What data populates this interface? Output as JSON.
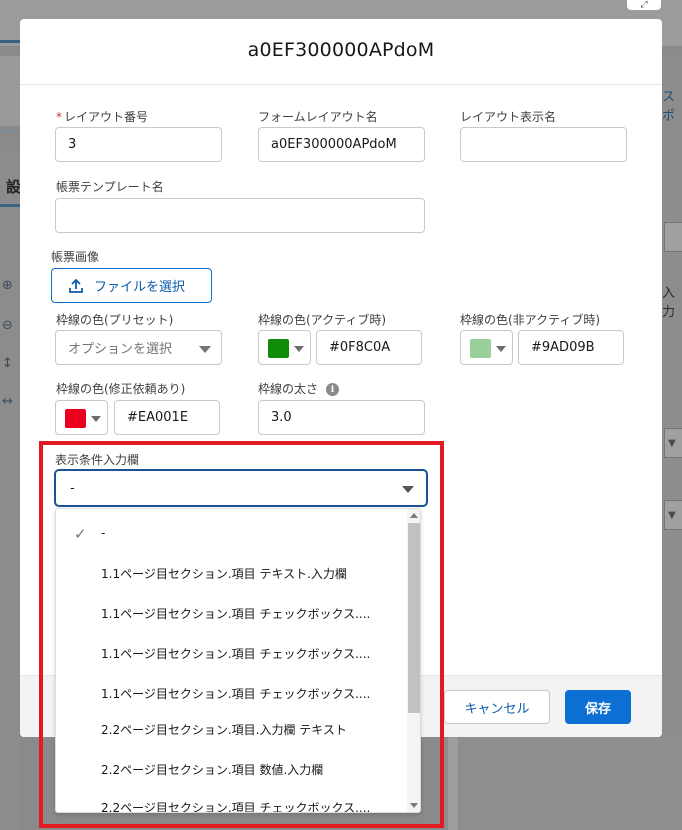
{
  "modal": {
    "title": "a0EF300000APdoM",
    "fields": {
      "layout_number_label": "レイアウト番号",
      "layout_number_required": "*",
      "layout_number_value": "3",
      "form_layout_name_label": "フォームレイアウト名",
      "form_layout_name_value": "a0EF300000APdoM",
      "layout_display_name_label": "レイアウト表示名",
      "layout_display_name_value": "",
      "template_name_label": "帳票テンプレート名",
      "template_name_value": "",
      "form_image_label": "帳票画像",
      "upload_button_label": "ファイルを選択",
      "border_preset_label": "枠線の色(プリセット)",
      "border_preset_placeholder": "オプションを選択",
      "border_active_label": "枠線の色(アクティブ時)",
      "border_active_value": "#0F8C0A",
      "border_active_color": "#0F8C0A",
      "border_inactive_label": "枠線の色(非アクティブ時)",
      "border_inactive_value": "#9AD09B",
      "border_inactive_color": "#9AD09B",
      "border_revision_label": "枠線の色(修正依頼あり)",
      "border_revision_value": "#EA001E",
      "border_revision_color": "#EA001E",
      "border_width_label": "枠線の太さ",
      "border_width_value": "3.0",
      "condition_label": "表示条件入力欄",
      "condition_value": "-"
    },
    "dropdown_options": [
      {
        "label": "-",
        "selected": true
      },
      {
        "label": "1.1ページ目セクション.項目 テキスト.入力欄",
        "selected": false
      },
      {
        "label": "1.1ページ目セクション.項目 チェックボックス....",
        "selected": false
      },
      {
        "label": "1.1ページ目セクション.項目 チェックボックス....",
        "selected": false
      },
      {
        "label": "1.1ページ目セクション.項目 チェックボックス....",
        "selected": false
      },
      {
        "label": "2.2ページ目セクション.項目.入力欄 テキスト",
        "selected": false
      },
      {
        "label": "2.2ページ目セクション.項目 数値.入力欄",
        "selected": false
      },
      {
        "label": "2.2ページ目セクション.項目 チェックボックス....",
        "selected": false
      }
    ],
    "footer": {
      "cancel_label": "キャンセル",
      "save_label": "保存"
    }
  },
  "background": {
    "left_heading_partial": "設",
    "right_link_partial": "スポ",
    "right_text_partial": "入力"
  },
  "colors": {
    "primary": "#0B6FD4",
    "highlight_box": "#E21B23"
  }
}
